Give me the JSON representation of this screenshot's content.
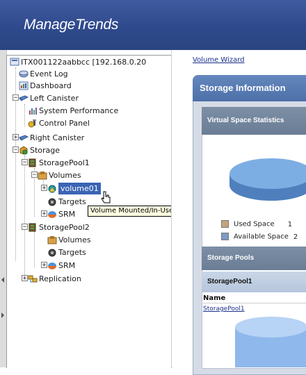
{
  "app": {
    "title": "ManageTrends"
  },
  "tree": {
    "root": "ITX001122aabbcc [192.168.0.20",
    "event_log": "Event Log",
    "dashboard": "Dashboard",
    "left_canister": "Left Canister",
    "system_performance": "System Performance",
    "control_panel": "Control Panel",
    "right_canister": "Right Canister",
    "storage": "Storage",
    "storage_pool1": "StoragePool1",
    "volumes1": "Volumes",
    "volume01": "volume01",
    "targets1": "Targets",
    "srm1": "SRM",
    "storage_pool2": "StoragePool2",
    "volumes2": "Volumes",
    "targets2": "Targets",
    "srm2": "SRM",
    "replication": "Replication",
    "tooltip": "Volume Mounted/In-Use"
  },
  "content": {
    "wizard_link": "Volume Wizard",
    "panel_title": "Storage Information",
    "virtual_space_header": "Virtual Space Statistics",
    "legend_used": "Used Space",
    "legend_used_value": "1",
    "legend_available": "Available Space",
    "legend_available_value": "2",
    "storage_pools_header": "Storage Pools",
    "pool_name": "StoragePool1",
    "name_col": "Name",
    "pool_link": "StoragePool1"
  },
  "colors": {
    "header_bg": "#2f4a8c",
    "panel_title_bg": "#5579b3",
    "used_space": "#c8a27d",
    "available_space": "#7e9ac6",
    "pie": "#6fa0da",
    "selected": "#3a64b4"
  }
}
